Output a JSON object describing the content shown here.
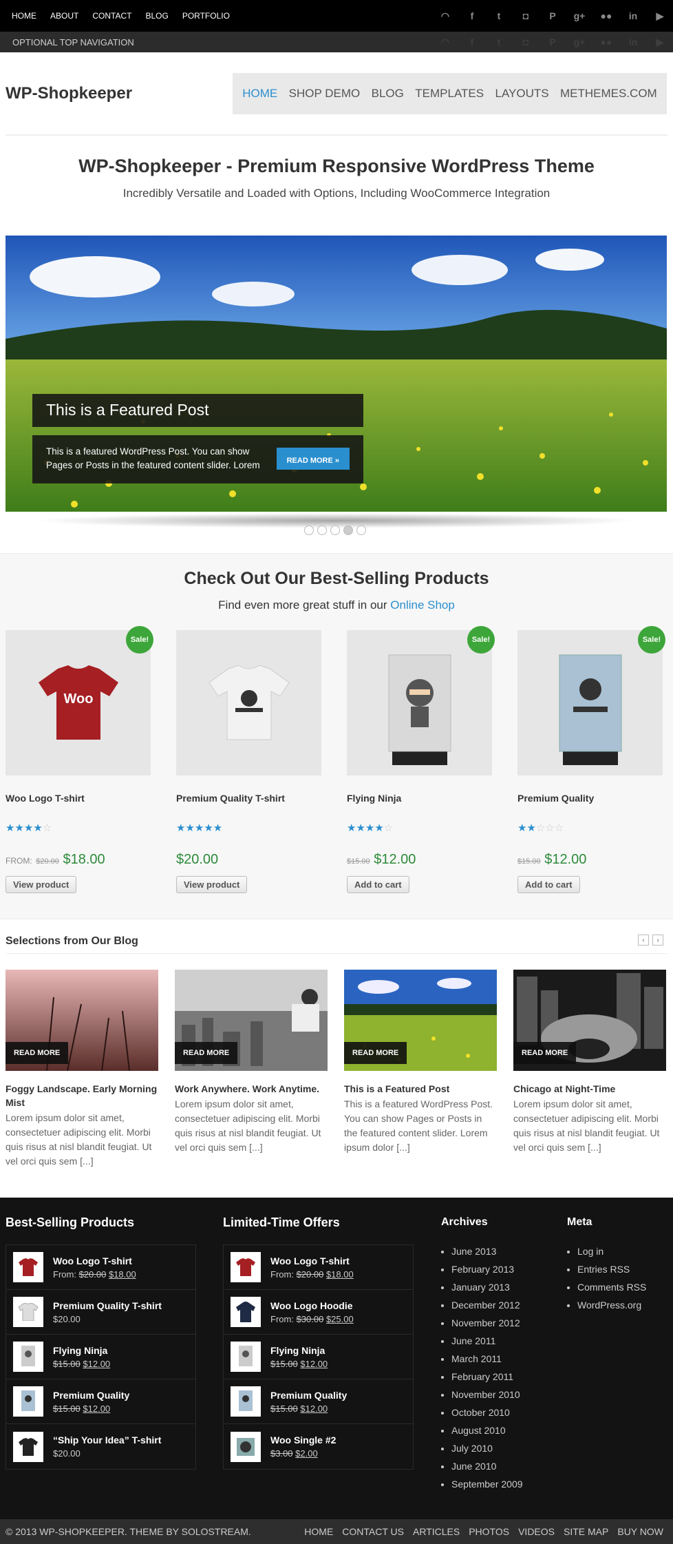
{
  "topnav": {
    "items": [
      "HOME",
      "ABOUT",
      "CONTACT",
      "BLOG",
      "PORTFOLIO"
    ]
  },
  "social": {
    "icons": [
      "rss-icon",
      "facebook-icon",
      "twitter-icon",
      "instagram-icon",
      "pinterest-icon",
      "googleplus-icon",
      "flickr-icon",
      "linkedin-icon",
      "youtube-icon"
    ],
    "glyphs": [
      "◠",
      "f",
      "t",
      "◘",
      "P",
      "g+",
      "●●",
      "in",
      "▶"
    ]
  },
  "optnav": {
    "label": "OPTIONAL TOP NAVIGATION"
  },
  "site": {
    "logo": "WP-Shopkeeper"
  },
  "mainnav": {
    "items": [
      "HOME",
      "SHOP DEMO",
      "BLOG",
      "TEMPLATES",
      "LAYOUTS",
      "METHEMES.COM"
    ]
  },
  "tagline": {
    "title": "WP-Shopkeeper - Premium Responsive WordPress Theme",
    "subtitle": "Incredibly Versatile and Loaded with Options, Including WooCommerce Integration"
  },
  "featured": {
    "title": "This is a Featured Post",
    "text": "This is a featured WordPress Post. You can show Pages or Posts in the featured content slider. Lorem",
    "button": "READ MORE »"
  },
  "products_section": {
    "title": "Check Out Our Best-Selling Products",
    "sub_prefix": "Find even more great stuff in our ",
    "sub_link": "Online Shop"
  },
  "products": [
    {
      "name": "Woo Logo T-shirt",
      "sale": "Sale!",
      "from": "FROM:",
      "old": "$20.00",
      "price": "$18.00",
      "button": "View product",
      "stars": "★★★★",
      "stars_off": "☆"
    },
    {
      "name": "Premium Quality T-shirt",
      "sale": "",
      "from": "",
      "old": "",
      "price": "$20.00",
      "button": "View product",
      "stars": "★★★★★",
      "stars_off": ""
    },
    {
      "name": "Flying Ninja",
      "sale": "Sale!",
      "from": "",
      "old": "$15.00",
      "price": "$12.00",
      "button": "Add to cart",
      "stars": "★★★★",
      "stars_off": "☆"
    },
    {
      "name": "Premium Quality",
      "sale": "Sale!",
      "from": "",
      "old": "$15.00",
      "price": "$12.00",
      "button": "Add to cart",
      "stars": "★★",
      "stars_off": "☆☆☆"
    }
  ],
  "blog": {
    "title": "Selections from Our Blog",
    "read_more": "READ MORE",
    "prev": "‹",
    "next": "›",
    "posts": [
      {
        "title": "Foggy Landscape. Early Morning Mist",
        "excerpt": "Lorem ipsum dolor sit amet, consectetuer adipiscing elit. Morbi quis risus at nisl blandit feugiat. Ut vel orci quis sem [...]"
      },
      {
        "title": "Work Anywhere. Work Anytime.",
        "excerpt": "Lorem ipsum dolor sit amet, consectetuer adipiscing elit. Morbi quis risus at nisl blandit feugiat. Ut vel orci quis sem [...]"
      },
      {
        "title": "This is a Featured Post",
        "excerpt": "This is a featured WordPress Post. You can show Pages or Posts in the featured content slider. Lorem ipsum dolor [...]"
      },
      {
        "title": "Chicago at Night-Time",
        "excerpt": "Lorem ipsum dolor sit amet, consectetuer adipiscing elit. Morbi quis risus at nisl blandit feugiat. Ut vel orci quis sem [...]"
      }
    ]
  },
  "footer": {
    "best": {
      "title": "Best-Selling Products",
      "items": [
        {
          "name": "Woo Logo T-shirt",
          "prefix": "From: ",
          "old": "$20.00",
          "price": "$18.00"
        },
        {
          "name": "Premium Quality T-shirt",
          "prefix": "",
          "old": "",
          "price": "$20.00"
        },
        {
          "name": "Flying Ninja",
          "prefix": "",
          "old": "$15.00",
          "price": "$12.00"
        },
        {
          "name": "Premium Quality",
          "prefix": "",
          "old": "$15.00",
          "price": "$12.00"
        },
        {
          "name": "“Ship Your Idea” T-shirt",
          "prefix": "",
          "old": "",
          "price": "$20.00"
        }
      ]
    },
    "offers": {
      "title": "Limited-Time Offers",
      "items": [
        {
          "name": "Woo Logo T-shirt",
          "prefix": "From: ",
          "old": "$20.00",
          "price": "$18.00"
        },
        {
          "name": "Woo Logo Hoodie",
          "prefix": "From: ",
          "old": "$30.00",
          "price": "$25.00"
        },
        {
          "name": "Flying Ninja",
          "prefix": "",
          "old": "$15.00",
          "price": "$12.00"
        },
        {
          "name": "Premium Quality",
          "prefix": "",
          "old": "$15.00",
          "price": "$12.00"
        },
        {
          "name": "Woo Single #2",
          "prefix": "",
          "old": "$3.00",
          "price": "$2.00"
        }
      ]
    },
    "archives": {
      "title": "Archives",
      "items": [
        "June 2013",
        "February 2013",
        "January 2013",
        "December 2012",
        "November 2012",
        "June 2011",
        "March 2011",
        "February 2011",
        "November 2010",
        "October 2010",
        "August 2010",
        "July 2010",
        "June 2010",
        "September 2009"
      ]
    },
    "meta": {
      "title": "Meta",
      "items": [
        "Log in",
        "Entries RSS",
        "Comments RSS",
        "WordPress.org"
      ]
    }
  },
  "bottom": {
    "copyright": "© 2013 WP-SHOPKEEPER. THEME BY SOLOSTREAM.",
    "nav": [
      "HOME",
      "CONTACT US",
      "ARTICLES",
      "PHOTOS",
      "VIDEOS",
      "SITE MAP",
      "BUY NOW"
    ]
  }
}
